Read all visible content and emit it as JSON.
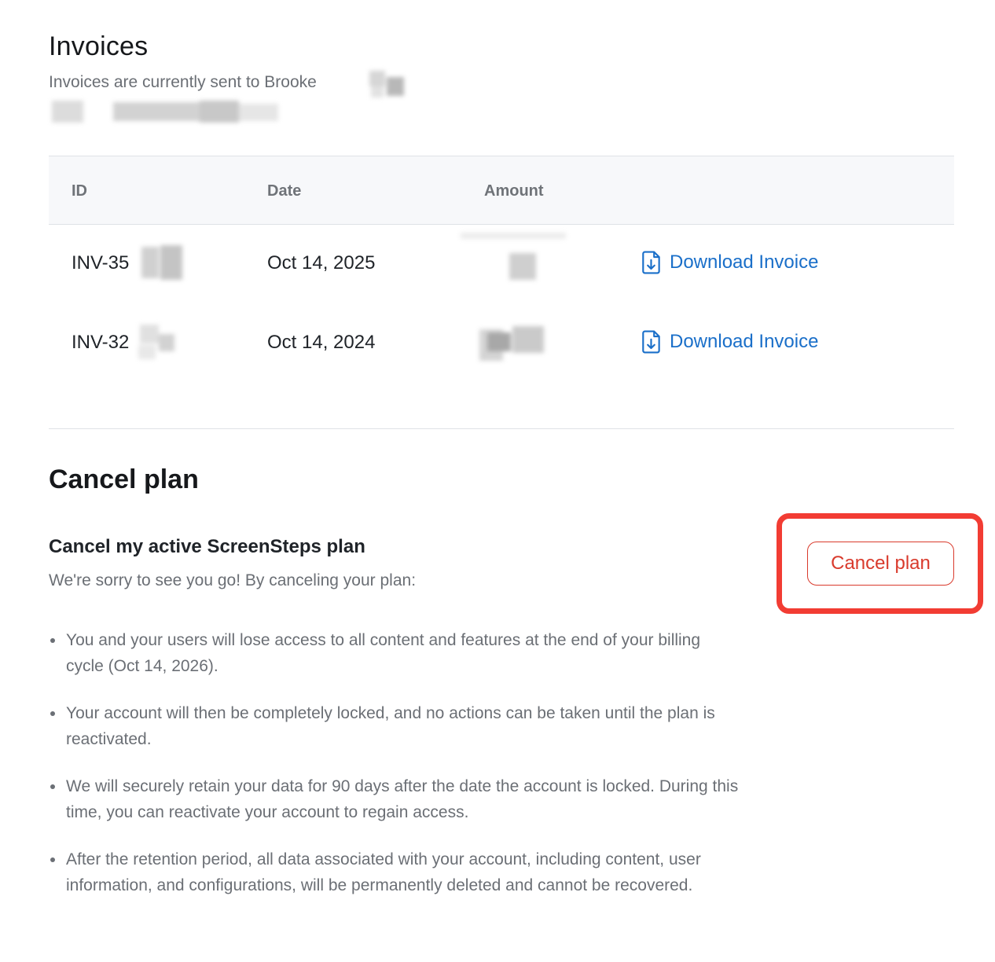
{
  "invoices": {
    "title": "Invoices",
    "subtitle": "Invoices are currently sent to Brooke",
    "columns": {
      "id": "ID",
      "date": "Date",
      "amount": "Amount"
    },
    "rows": [
      {
        "id": "INV-35",
        "date": "Oct 14, 2025",
        "action": "Download Invoice"
      },
      {
        "id": "INV-32",
        "date": "Oct 14, 2024",
        "action": "Download Invoice"
      }
    ]
  },
  "cancel_section": {
    "title": "Cancel plan",
    "heading": "Cancel my active ScreenSteps plan",
    "intro": "We're sorry to see you go! By canceling your plan:",
    "bullets": [
      "You and your users will lose access to all content and features at the end of your billing cycle (Oct 14, 2026).",
      "Your account will then be completely locked, and no actions can be taken until the plan is reactivated.",
      "We will securely retain your data for 90 days after the date the account is locked. During this time, you can reactivate your account to regain access.",
      "After the retention period, all data associated with your account, including content, user information, and configurations, will be permanently deleted and cannot be recovered."
    ],
    "button_label": "Cancel plan"
  },
  "colors": {
    "link": "#1a6fc9",
    "danger": "#d93a2c",
    "highlight": "#f23c33"
  },
  "icons": {
    "download": "file-download-icon"
  }
}
